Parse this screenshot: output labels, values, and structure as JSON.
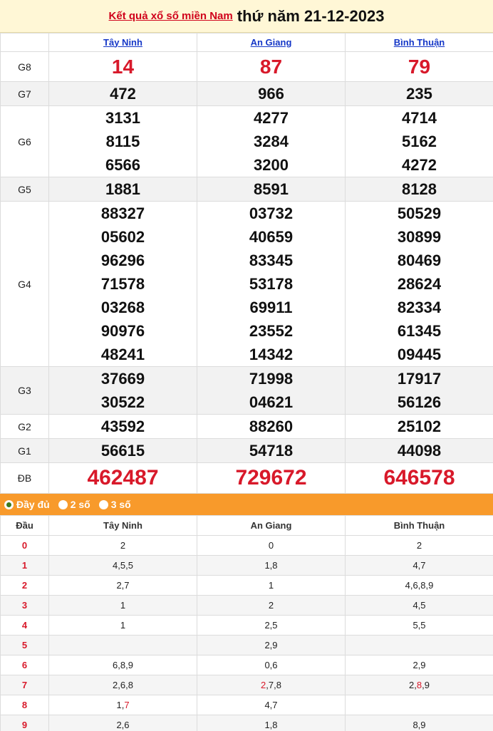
{
  "header": {
    "link_text": "Kết quả xổ số miền Nam",
    "date_text": "thứ năm 21-12-2023"
  },
  "provinces": [
    "Tây Ninh",
    "An Giang",
    "Bình Thuận"
  ],
  "prizes": [
    {
      "label": "G8",
      "values": [
        [
          "14"
        ],
        [
          "87"
        ],
        [
          "79"
        ]
      ]
    },
    {
      "label": "G7",
      "values": [
        [
          "472"
        ],
        [
          "966"
        ],
        [
          "235"
        ]
      ]
    },
    {
      "label": "G6",
      "values": [
        [
          "3131",
          "8115",
          "6566"
        ],
        [
          "4277",
          "3284",
          "3200"
        ],
        [
          "4714",
          "5162",
          "4272"
        ]
      ]
    },
    {
      "label": "G5",
      "values": [
        [
          "1881"
        ],
        [
          "8591"
        ],
        [
          "8128"
        ]
      ]
    },
    {
      "label": "G4",
      "values": [
        [
          "88327",
          "05602",
          "96296",
          "71578",
          "03268",
          "90976",
          "48241"
        ],
        [
          "03732",
          "40659",
          "83345",
          "53178",
          "69911",
          "23552",
          "14342"
        ],
        [
          "50529",
          "30899",
          "80469",
          "28624",
          "82334",
          "61345",
          "09445"
        ]
      ]
    },
    {
      "label": "G3",
      "values": [
        [
          "37669",
          "30522"
        ],
        [
          "71998",
          "04621"
        ],
        [
          "17917",
          "56126"
        ]
      ]
    },
    {
      "label": "G2",
      "values": [
        [
          "43592"
        ],
        [
          "88260"
        ],
        [
          "25102"
        ]
      ]
    },
    {
      "label": "G1",
      "values": [
        [
          "56615"
        ],
        [
          "54718"
        ],
        [
          "44098"
        ]
      ]
    },
    {
      "label": "ĐB",
      "values": [
        [
          "462487"
        ],
        [
          "729672"
        ],
        [
          "646578"
        ]
      ]
    }
  ],
  "options": {
    "full": "Đầy đủ",
    "two": "2 số",
    "three": "3 số",
    "selected": "full"
  },
  "loto": {
    "head_label": "Đầu",
    "columns": [
      "Tây Ninh",
      "An Giang",
      "Bình Thuận"
    ],
    "rows": [
      {
        "dau": "0",
        "cells": [
          "2",
          "0",
          "2"
        ]
      },
      {
        "dau": "1",
        "cells": [
          "4,5,5",
          "1,8",
          "4,7"
        ]
      },
      {
        "dau": "2",
        "cells": [
          "2,7",
          "1",
          "4,6,8,9"
        ]
      },
      {
        "dau": "3",
        "cells": [
          "1",
          "2",
          "4,5"
        ]
      },
      {
        "dau": "4",
        "cells": [
          "1",
          "2,5",
          "5,5"
        ]
      },
      {
        "dau": "5",
        "cells": [
          "",
          "2,9",
          ""
        ]
      },
      {
        "dau": "6",
        "cells": [
          "6,8,9",
          "0,6",
          "2,9"
        ]
      },
      {
        "dau": "7",
        "cells": [
          "2,6,8",
          "2,7,8",
          "2,8,9"
        ]
      },
      {
        "dau": "8",
        "cells": [
          "1,7",
          "4,7",
          ""
        ]
      },
      {
        "dau": "9",
        "cells": [
          "2,6",
          "1,8",
          "8,9"
        ]
      }
    ],
    "highlight_color": "#d8192a",
    "highlights": [
      {
        "row": 7,
        "col": 1,
        "digit": "2"
      },
      {
        "row": 7,
        "col": 2,
        "digit": "8"
      },
      {
        "row": 8,
        "col": 0,
        "digit": "7"
      }
    ]
  }
}
